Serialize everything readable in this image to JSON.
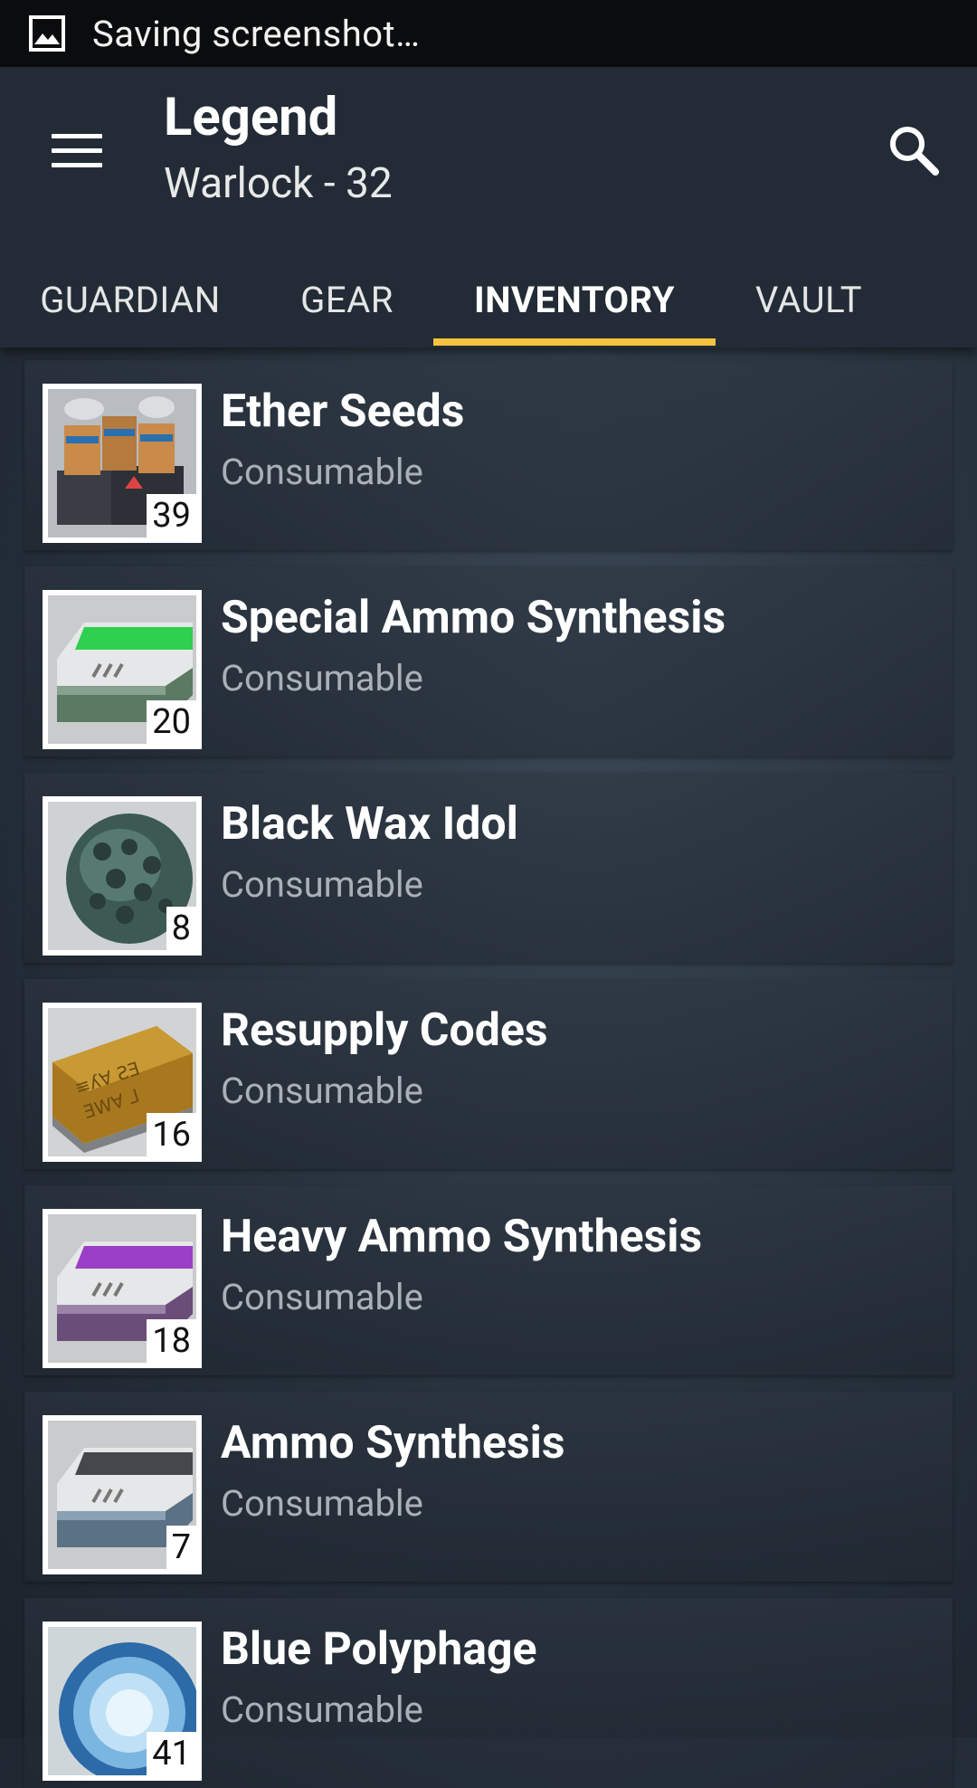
{
  "status_bar": {
    "text": "Saving screenshot…"
  },
  "app_bar": {
    "title": "Legend",
    "subtitle": "Warlock - 32"
  },
  "tabs": [
    {
      "label": "GUARDIAN",
      "active": false
    },
    {
      "label": "GEAR",
      "active": false
    },
    {
      "label": "INVENTORY",
      "active": true
    },
    {
      "label": "VAULT",
      "active": false
    }
  ],
  "colors": {
    "tab_indicator": "#f5c33d",
    "app_bar": "#232c36"
  },
  "items": [
    {
      "name": "Ether Seeds",
      "type": "Consumable",
      "quantity": "39",
      "icon": "ether-seeds-icon"
    },
    {
      "name": "Special Ammo Synthesis",
      "type": "Consumable",
      "quantity": "20",
      "icon": "special-ammo-synthesis-icon"
    },
    {
      "name": "Black Wax Idol",
      "type": "Consumable",
      "quantity": "8",
      "icon": "black-wax-idol-icon"
    },
    {
      "name": "Resupply Codes",
      "type": "Consumable",
      "quantity": "16",
      "icon": "resupply-codes-icon"
    },
    {
      "name": "Heavy Ammo Synthesis",
      "type": "Consumable",
      "quantity": "18",
      "icon": "heavy-ammo-synthesis-icon"
    },
    {
      "name": "Ammo Synthesis",
      "type": "Consumable",
      "quantity": "7",
      "icon": "ammo-synthesis-icon"
    },
    {
      "name": "Blue Polyphage",
      "type": "Consumable",
      "quantity": "41",
      "icon": "blue-polyphage-icon"
    }
  ]
}
